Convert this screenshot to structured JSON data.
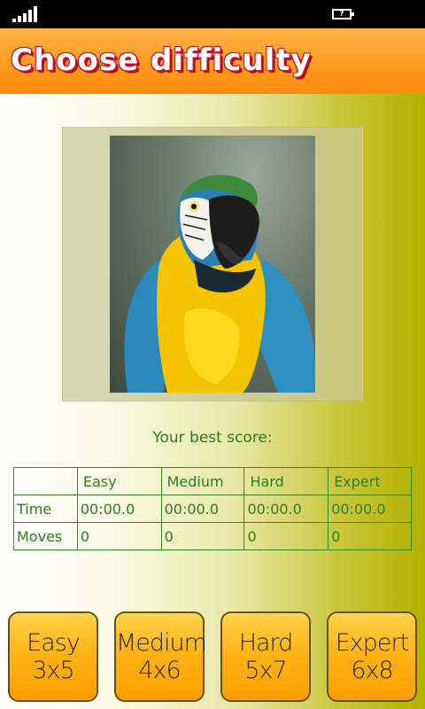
{
  "header": {
    "title": "Choose difficulty"
  },
  "status": {
    "battery_label": "?"
  },
  "best_score": {
    "label": "Your best score:",
    "columns": [
      "",
      "Easy",
      "Medium",
      "Hard",
      "Expert"
    ],
    "rows": [
      {
        "label": "Time",
        "values": [
          "00:00.0",
          "00:00.0",
          "00:00.0",
          "00:00.0"
        ]
      },
      {
        "label": "Moves",
        "values": [
          "0",
          "0",
          "0",
          "0"
        ]
      }
    ]
  },
  "buttons": [
    {
      "name": "Easy",
      "size": "3x5"
    },
    {
      "name": "Medium",
      "size": "4x6"
    },
    {
      "name": "Hard",
      "size": "5x7"
    },
    {
      "name": "Expert",
      "size": "6x8"
    }
  ],
  "colors": {
    "header": "#ff9a1e",
    "title_outline": "#c8102e",
    "table_text": "#2e7d1e",
    "button_fill": "#ffb418"
  },
  "image": {
    "subject_icon": "parrot-photo"
  }
}
